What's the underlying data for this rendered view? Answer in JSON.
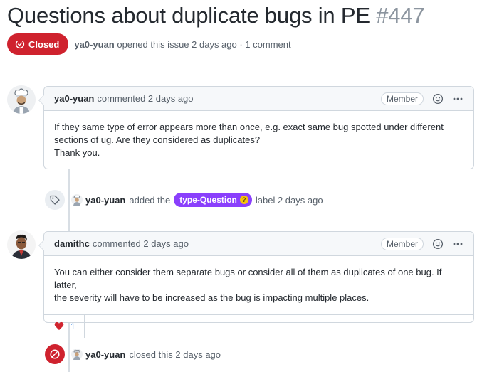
{
  "issue": {
    "title": "Questions about duplicate bugs in PE",
    "number": "#447",
    "state_label": "Closed",
    "state_color": "#cf222e",
    "opener": "ya0-yuan",
    "meta_rest": "opened this issue 2 days ago · 1 comment"
  },
  "comments": [
    {
      "author": "ya0-yuan",
      "when": "commented 2 days ago",
      "role_badge": "Member",
      "body_lines": [
        "If they same type of error appears more than once, e.g. exact same bug spotted under different",
        "sections of ug. Are they considered as duplicates?",
        "Thank you."
      ]
    },
    {
      "author": "damithc",
      "when": "commented 2 days ago",
      "role_badge": "Member",
      "body_lines": [
        "You can either consider them separate bugs or consider all of them as duplicates of one bug. If latter,",
        "the severity will have to be increased as the bug is impacting multiple places."
      ],
      "reaction_count": "1"
    }
  ],
  "events": {
    "label_event": {
      "actor": "ya0-yuan",
      "pre": "added the",
      "label": "type-Question",
      "label_color": "#8a3ffc",
      "post": "label 2 days ago"
    },
    "closed_event": {
      "actor": "ya0-yuan",
      "text": "closed this 2 days ago"
    }
  },
  "icons": [
    "issue-closed-icon",
    "smiley-icon",
    "kebab-horizontal-icon",
    "tag-icon",
    "heart-icon",
    "skip-icon"
  ]
}
